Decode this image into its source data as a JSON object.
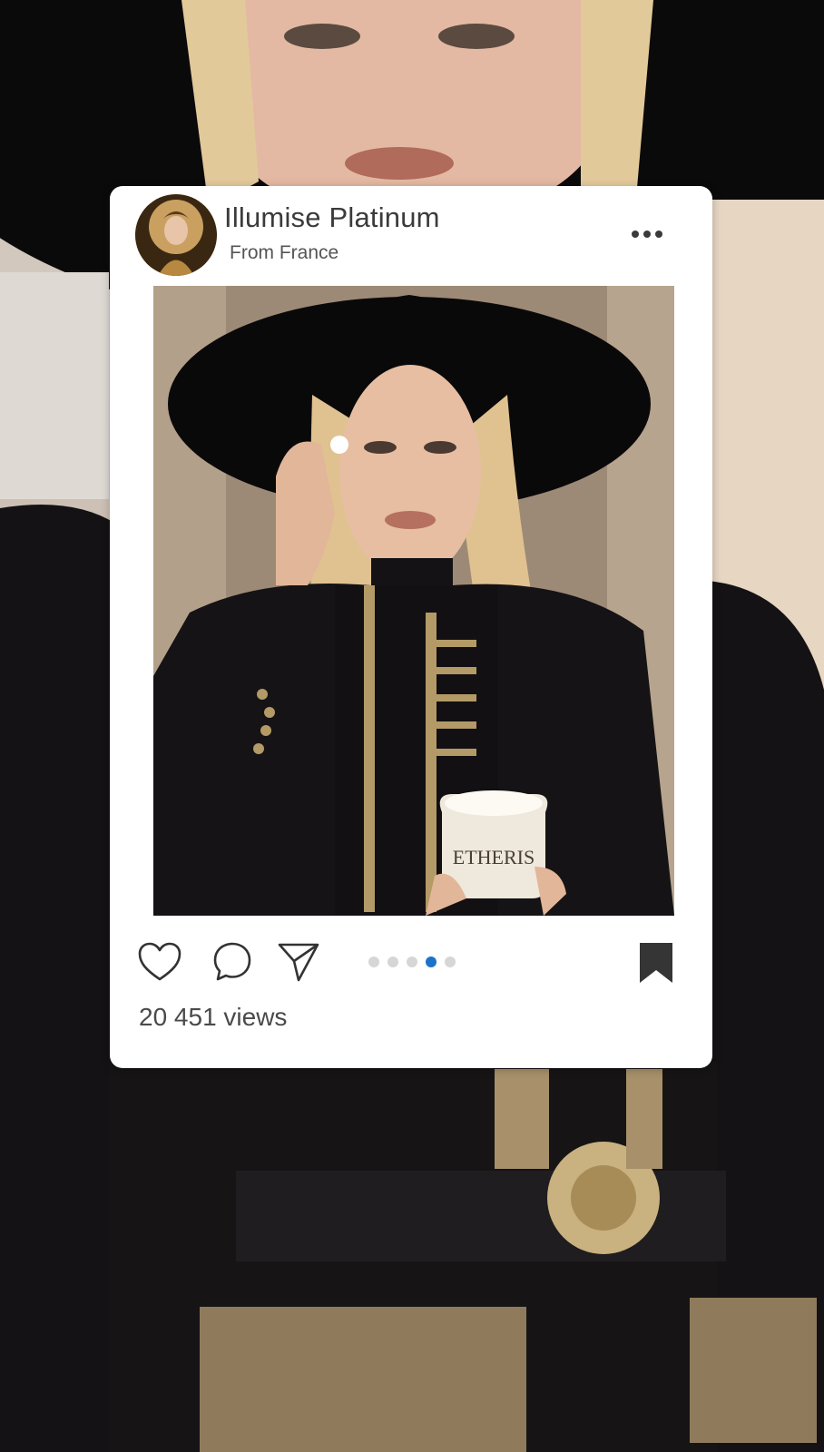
{
  "post": {
    "account_name": "Illumise Platinum",
    "location": "From France",
    "more_icon": "more-horizontal-icon",
    "image": {
      "product_label": "ETHERIS"
    },
    "actions": {
      "like_icon": "heart-icon",
      "comment_icon": "comment-bubble-icon",
      "share_icon": "send-paper-plane-icon",
      "bookmark_icon": "bookmark-icon"
    },
    "carousel": {
      "total": 5,
      "active_index": 3,
      "active_color": "#1a73c8",
      "inactive_color": "#d6d6d6"
    },
    "views_label": "20 451 views"
  },
  "colors": {
    "card_background": "#ffffff",
    "text_primary": "#3b3b3b",
    "text_secondary": "#555555"
  }
}
